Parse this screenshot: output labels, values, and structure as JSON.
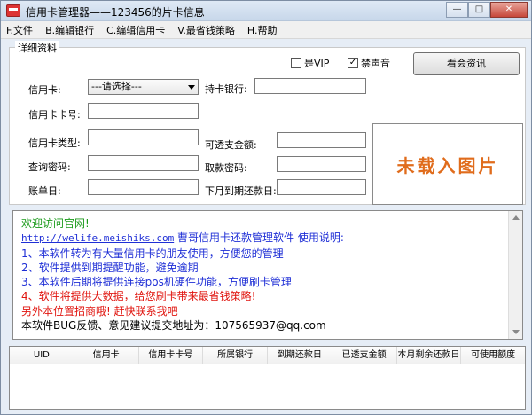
{
  "window": {
    "title": "信用卡管理器——123456的片卡信息",
    "controls": {
      "minimize": "—",
      "maximize": "□",
      "close": "✕"
    }
  },
  "menu": [
    "F.文件",
    "B.编辑银行",
    "C.编辑信用卡",
    "V.最省钱策略",
    "H.帮助"
  ],
  "details": {
    "group_title": "详细资料",
    "vip_label": "是VIP",
    "vip_checked": false,
    "mute_label": "禁声音",
    "mute_checked": true,
    "news_button": "看会资讯",
    "card_label": "信用卡:",
    "card_select_value": "---请选择---",
    "bank_label": "持卡银行:",
    "card_number_label": "信用卡卡号:",
    "card_type_label": "信用卡类型:",
    "overdraft_label": "可透支金额:",
    "query_pwd_label": "查询密码:",
    "withdraw_pwd_label": "取款密码:",
    "bill_day_label": "账单日:",
    "next_due_label": "下月到期还款日:",
    "image_placeholder": "未载入图片"
  },
  "info": {
    "welcome": "欢迎访问官网!",
    "url": "http://welife.meishiks.com",
    "intro": " 曹哥信用卡还款管理软件 使用说明:",
    "items": [
      "1、本软件转为有大量信用卡的朋友使用，方便您的管理",
      "2、软件提供到期提醒功能，避免逾期",
      "3、本软件后期将提供连接pos机硬件功能，方便刷卡管理",
      "4、软件将提供大数据，给您刷卡带来最省钱策略!"
    ],
    "ad": "另外本位置招商哦! 赶快联系我吧",
    "feedback": "本软件BUG反馈、意见建议提交地址为：107565937@qq.com",
    "colors": {
      "green": "#1a9a1a",
      "blue": "#1f2fd6",
      "red": "#e0140e",
      "black": "#000000"
    }
  },
  "grid": {
    "columns": [
      "UID",
      "信用卡",
      "信用卡卡号",
      "所属银行",
      "到期还款日",
      "已透支金额",
      "本月剩余还款日",
      "可使用额度"
    ],
    "rows": []
  }
}
